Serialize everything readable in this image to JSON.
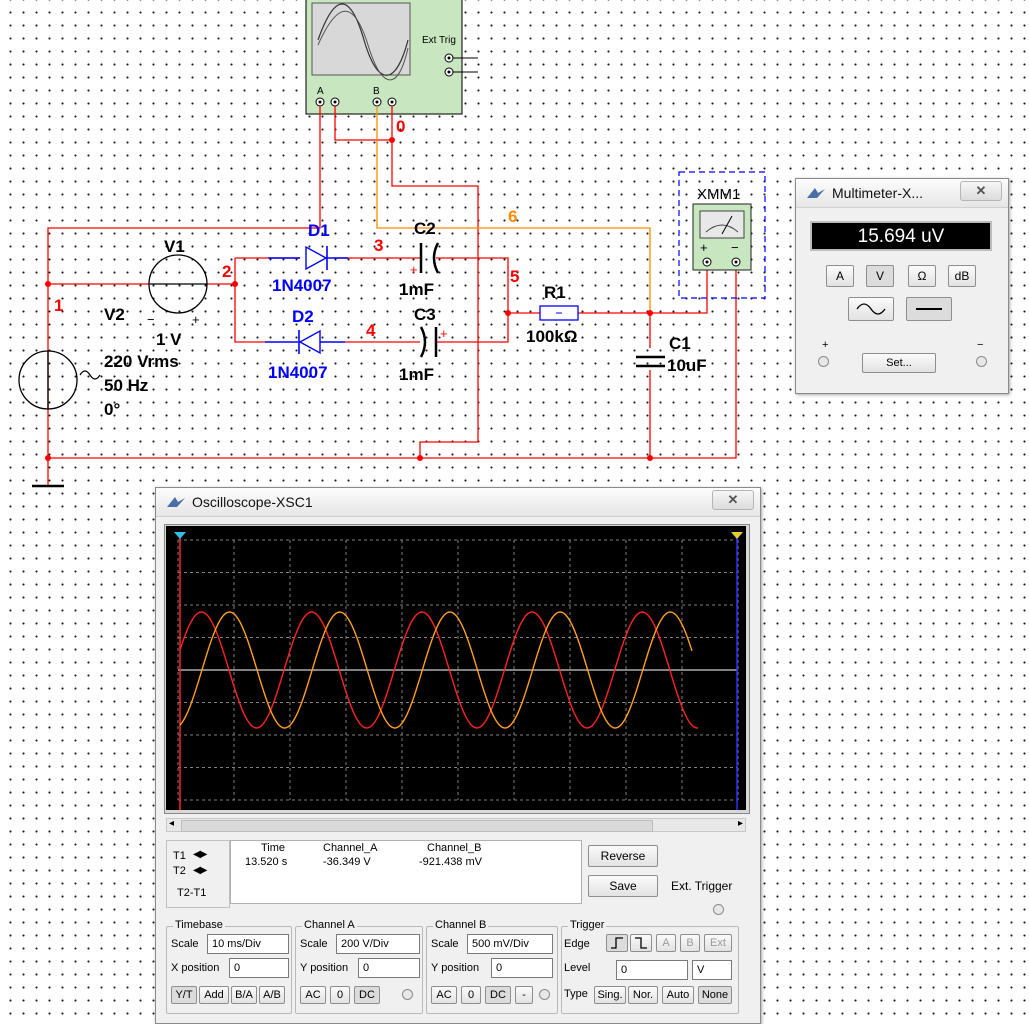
{
  "schematic": {
    "scope_ext_trig_label": "Ext Trig",
    "scope_ch_a": "A",
    "scope_ch_b": "B",
    "node_0": "0",
    "node_1": "1",
    "node_2": "2",
    "node_3": "3",
    "node_4": "4",
    "node_5": "5",
    "node_6": "6",
    "v1_ref": "V1",
    "v1_value": "1 V",
    "v2_ref": "V2",
    "v2_voltage": "220 Vrms",
    "v2_freq": "50 Hz",
    "v2_phase": "0°",
    "d1_ref": "D1",
    "d1_model": "1N4007",
    "d2_ref": "D2",
    "d2_model": "1N4007",
    "c2_ref": "C2",
    "c2_value": "1mF",
    "c3_ref": "C3",
    "c3_value": "1mF",
    "r1_ref": "R1",
    "r1_value": "100kΩ",
    "c1_ref": "C1",
    "c1_value": "10uF",
    "xmm1_ref": "XMM1",
    "plus": "+",
    "minus": "−",
    "colors": {
      "wire_red": "#ff0000",
      "wire_orange": "#ff8c00",
      "component_blue": "#0000ff",
      "instrument_green": "#c8e6c0"
    }
  },
  "multimeter": {
    "title": "Multimeter-X...",
    "close": "✕",
    "reading": "15.694 uV",
    "mode_buttons": [
      "A",
      "V",
      "Ω",
      "dB"
    ],
    "set_button": "Set...",
    "plus_terminal": "+",
    "minus_terminal": "−"
  },
  "oscilloscope": {
    "title": "Oscilloscope-XSC1",
    "close": "✕",
    "waveforms": {
      "screen_bg": "#000000",
      "grid_color": "#808080",
      "channel_a_color": "#ff2222",
      "channel_b_color": "#ffa020",
      "channel_a_cycles_visible": 4.7,
      "channel_b_cycles_visible": 4.5
    },
    "cursor_table": {
      "t1": "T1",
      "t2": "T2",
      "t2_t1": "T2-T1",
      "headers": [
        "Time",
        "Channel_A",
        "Channel_B"
      ],
      "row": [
        "13.520 s",
        "-36.349 V",
        "-921.438 mV"
      ]
    },
    "reverse_button": "Reverse",
    "save_button": "Save",
    "ext_trigger_label": "Ext. Trigger",
    "timebase": {
      "title": "Timebase",
      "scale_label": "Scale",
      "scale_value": "10 ms/Div",
      "xpos_label": "X position",
      "xpos_value": "0",
      "buttons": [
        "Y/T",
        "Add",
        "B/A",
        "A/B"
      ]
    },
    "channel_a": {
      "title": "Channel A",
      "scale_label": "Scale",
      "scale_value": "200  V/Div",
      "ypos_label": "Y position",
      "ypos_value": "0",
      "buttons": [
        "AC",
        "0",
        "DC"
      ]
    },
    "channel_b": {
      "title": "Channel B",
      "scale_label": "Scale",
      "scale_value": "500 mV/Div",
      "ypos_label": "Y position",
      "ypos_value": "0",
      "buttons": [
        "AC",
        "0",
        "DC",
        "-"
      ]
    },
    "trigger": {
      "title": "Trigger",
      "edge_label": "Edge",
      "edge_buttons": [
        "A",
        "B",
        "Ext"
      ],
      "level_label": "Level",
      "level_value": "0",
      "level_unit": "V",
      "type_label": "Type",
      "type_buttons": [
        "Sing.",
        "Nor.",
        "Auto",
        "None"
      ]
    }
  }
}
